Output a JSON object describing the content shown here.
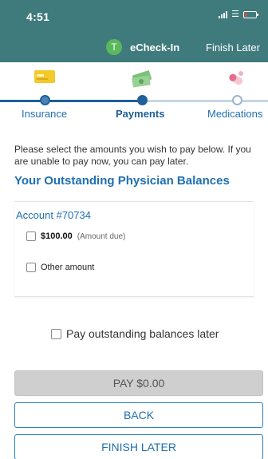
{
  "status_bar": {
    "time": "4:51",
    "signal_icon": "signal-icon",
    "wifi_icon": "wifi-icon",
    "battery_icon": "battery-icon"
  },
  "app_bar": {
    "logo_letter": "T",
    "title": "eCheck-In",
    "finish_label": "Finish Later"
  },
  "steps": [
    {
      "label": "Insurance",
      "icon": "insurance-card-icon",
      "state": "done"
    },
    {
      "label": "Payments",
      "icon": "cash-icon",
      "state": "current"
    },
    {
      "label": "Medications",
      "icon": "pill-icon",
      "state": "todo"
    }
  ],
  "instructions": "Please select the amounts you wish to pay below. If you are unable to pay now, you can pay later.",
  "section_title": "Your Outstanding Physician Balances",
  "account": {
    "title": "Account #70734",
    "amount": "$100.00",
    "amount_note": "(Amount due)",
    "other_label": "Other amount"
  },
  "pay_later_label": "Pay outstanding balances later",
  "buttons": {
    "pay": "PAY $0.00",
    "back": "BACK",
    "finish": "FINISH LATER"
  },
  "colors": {
    "header": "#3f7a7c",
    "accent": "#1f6fb0",
    "progress": "#1f5f9a"
  }
}
